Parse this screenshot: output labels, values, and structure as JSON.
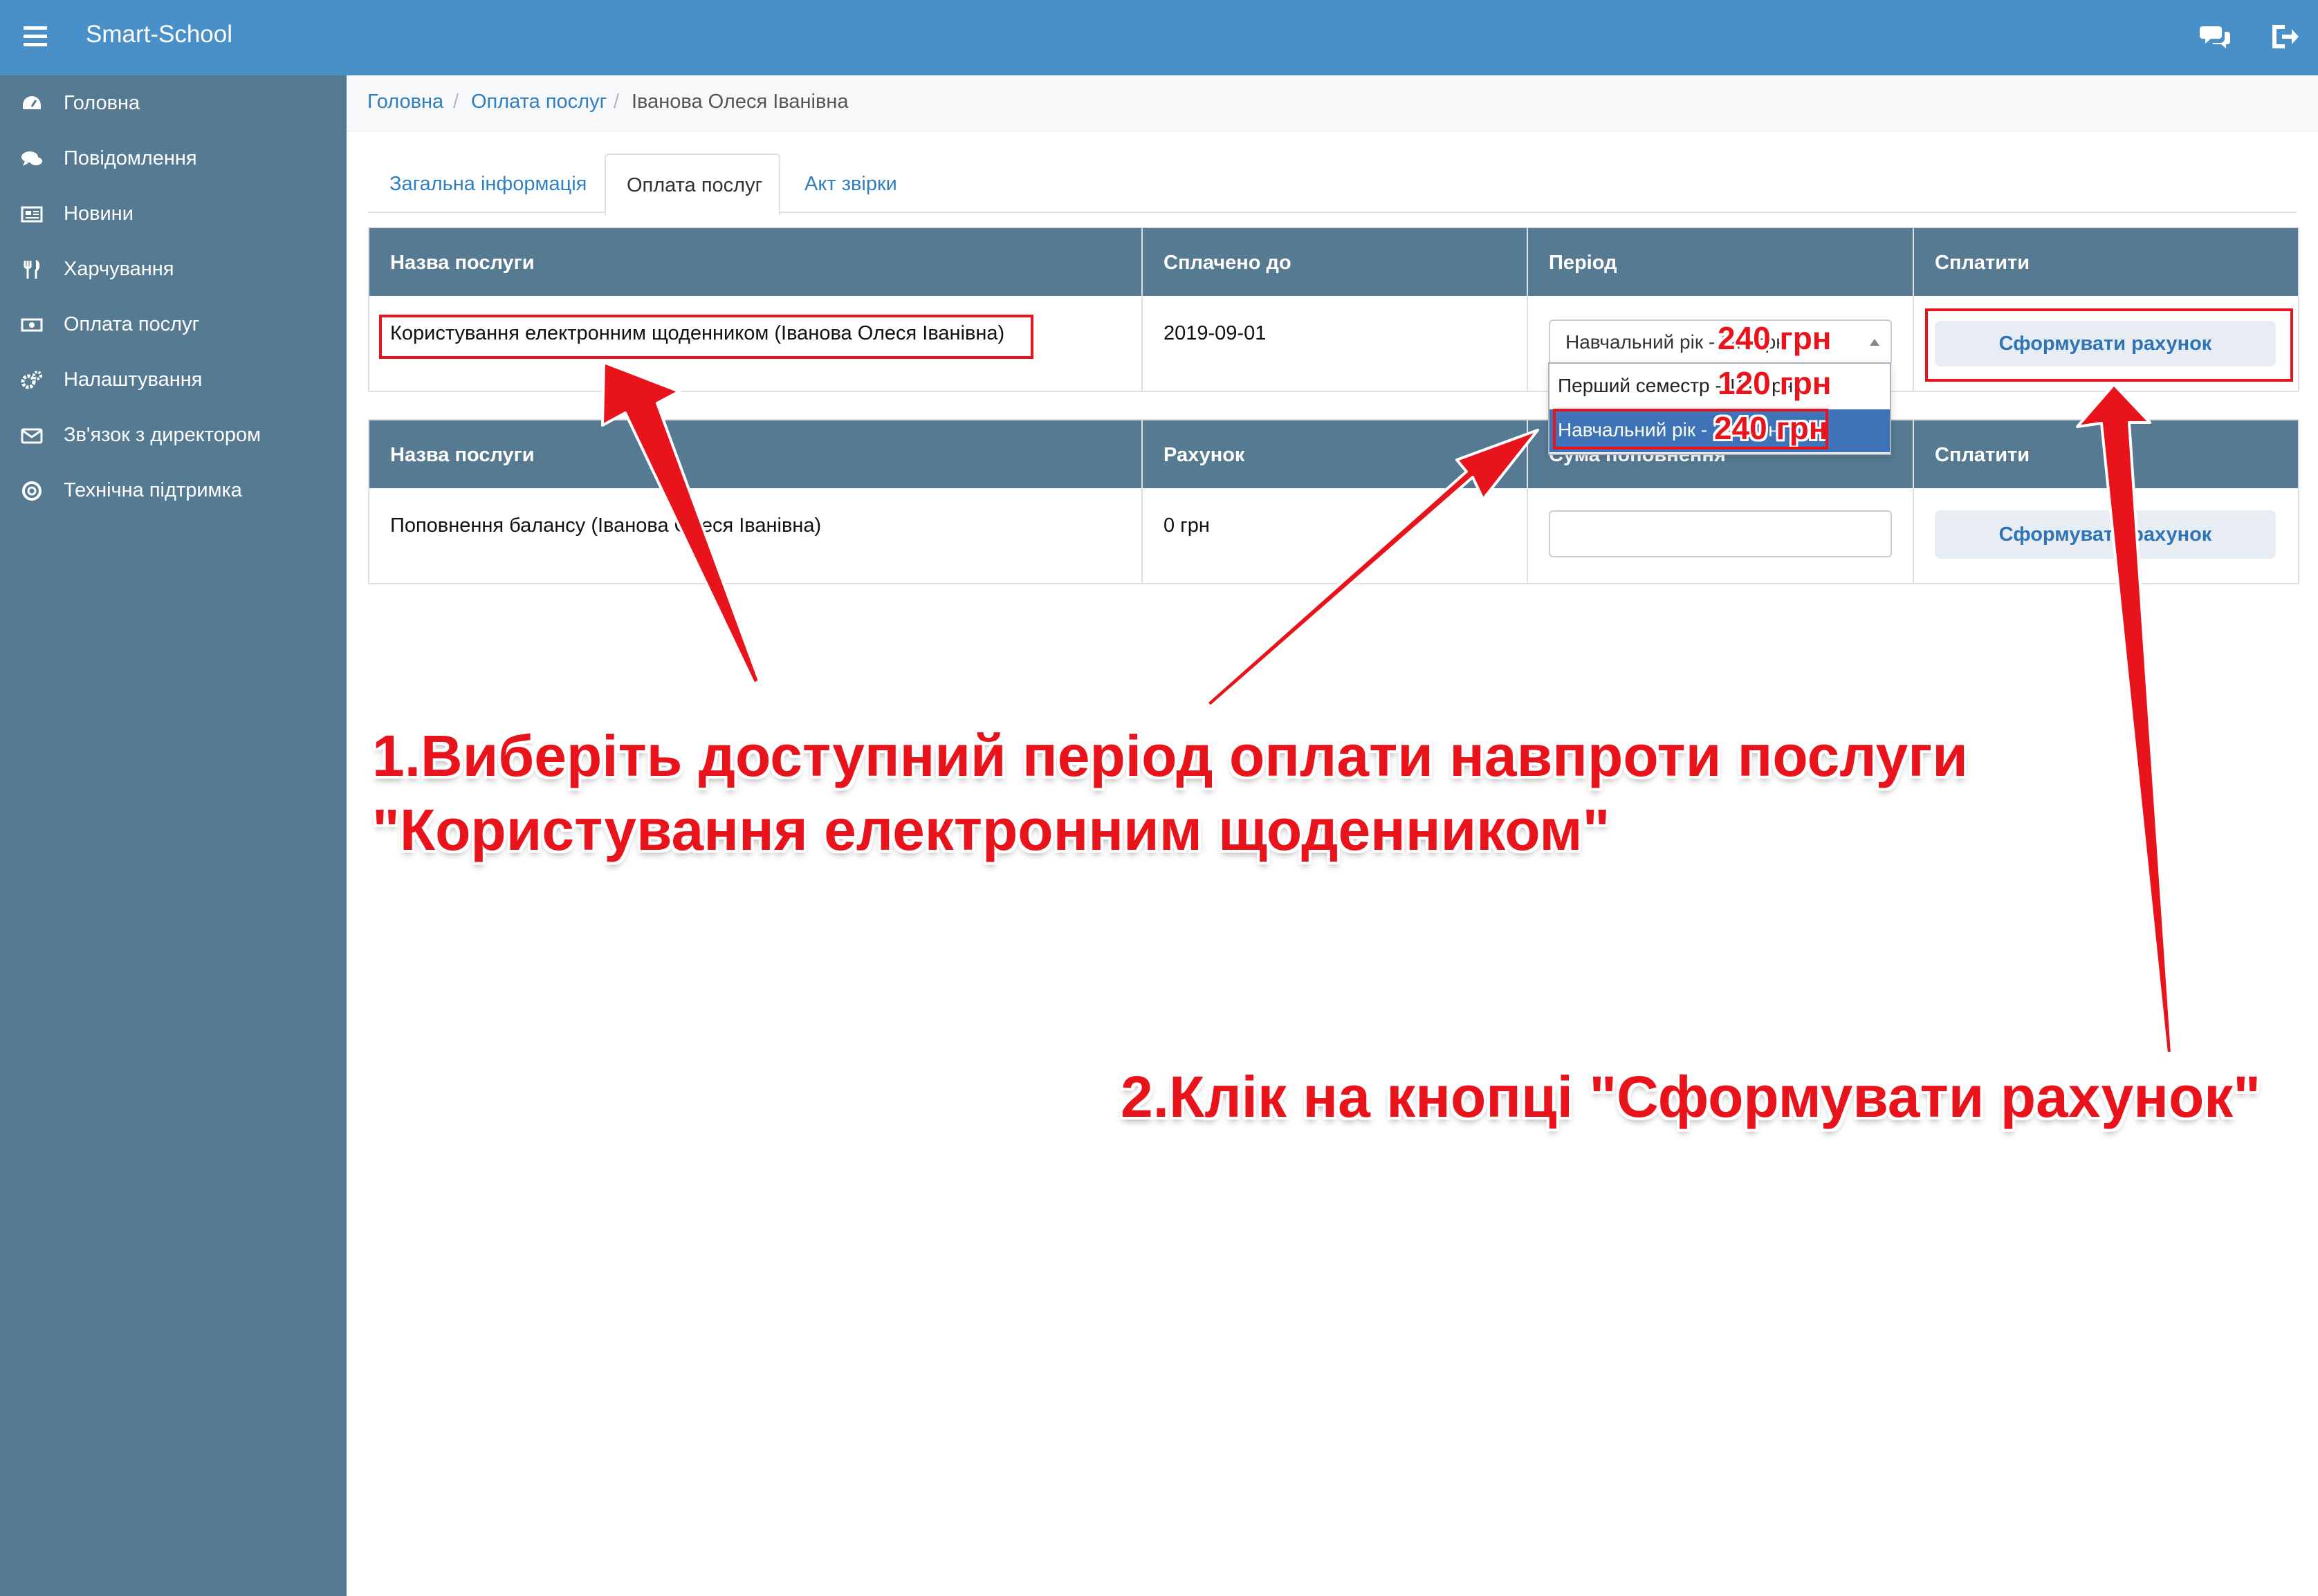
{
  "app": {
    "title": "Smart-School"
  },
  "sidebar": {
    "items": [
      {
        "label": "Головна",
        "icon": "dashboard-icon"
      },
      {
        "label": "Повідомлення",
        "icon": "comments-icon"
      },
      {
        "label": "Новини",
        "icon": "newspaper-icon"
      },
      {
        "label": "Харчування",
        "icon": "cutlery-icon"
      },
      {
        "label": "Оплата послуг",
        "icon": "money-icon"
      },
      {
        "label": "Налаштування",
        "icon": "gears-icon"
      },
      {
        "label": "Зв'язок з директором",
        "icon": "envelope-icon"
      },
      {
        "label": "Технічна підтримка",
        "icon": "life-ring-icon"
      }
    ]
  },
  "breadcrumb": {
    "items": [
      "Головна",
      "Оплата послуг"
    ],
    "current": "Іванова Олеся Іванівна",
    "separator": "/"
  },
  "tabs": [
    {
      "label": "Загальна інформація",
      "active": false
    },
    {
      "label": "Оплата послуг",
      "active": true
    },
    {
      "label": "Акт звірки",
      "active": false
    }
  ],
  "services_table": {
    "headers": [
      "Назва послуги",
      "Сплачено до",
      "Період",
      "Сплатити"
    ],
    "row": {
      "name": "Користування електронним щоденником (Іванова Олеся Іванівна)",
      "paid_until": "2019-09-01",
      "period_selected": "Навчальний рік - 240 грн",
      "period_options": [
        "Перший семестр - 120 грн",
        "Навчальний рік - 240 грн"
      ],
      "button": "Сформувати рахунок"
    }
  },
  "balance_table": {
    "headers": [
      "Назва послуги",
      "Рахунок",
      "Сума поповнення",
      "Сплатити"
    ],
    "row": {
      "name": "Поповнення балансу (Іванова Олеся Іванівна)",
      "account": "0 грн",
      "amount_value": "",
      "button": "Сформувати рахунок"
    }
  },
  "annotations": {
    "price_selected": "240 грн",
    "price_option1": "120 грн",
    "price_option2": "240 грн",
    "step1_line1": "1.Виберіть доступний період оплати навпроти послуги",
    "step1_line2": "\"Користування електронним щоденником\"",
    "step2": "2.Клік на кнопці \"Сформувати рахунок\"",
    "color": "#e8131b"
  },
  "colors": {
    "topbar": "#4a90c8",
    "sidebar": "#577a93",
    "table_header": "#577a93",
    "link": "#2f7fc0",
    "option_selected": "#3f73b8"
  }
}
